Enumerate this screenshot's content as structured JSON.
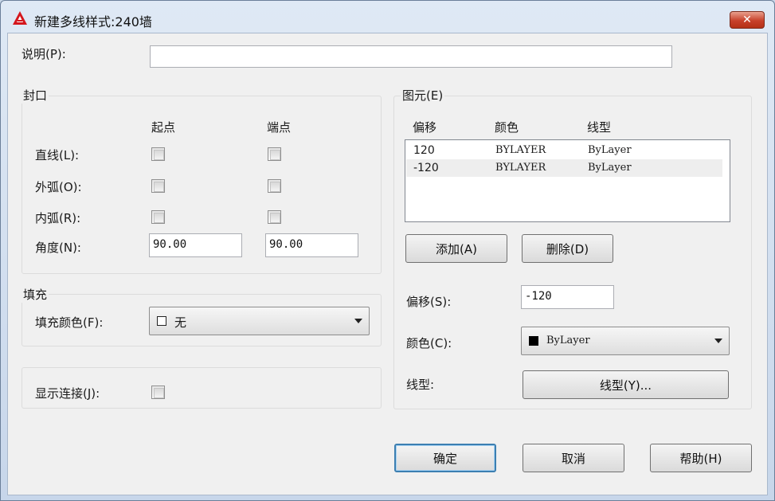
{
  "window": {
    "title": "新建多线样式:240墙",
    "close_label": "✕"
  },
  "description": {
    "label": "说明(P):",
    "value": ""
  },
  "caps": {
    "group_title": "封口",
    "col_start": "起点",
    "col_end": "端点",
    "line_label": "直线(L):",
    "outer_arc_label": "外弧(O):",
    "inner_arc_label": "内弧(R):",
    "angle_label": "角度(N):",
    "angle_start": "90.00",
    "angle_end": "90.00",
    "line_start_checked": false,
    "line_end_checked": false,
    "outer_start_checked": false,
    "outer_end_checked": false,
    "inner_start_checked": false,
    "inner_end_checked": false
  },
  "fill": {
    "group_title": "填充",
    "label": "填充颜色(F):",
    "value": "无"
  },
  "display_joints": {
    "label": "显示连接(J):",
    "checked": false
  },
  "elements": {
    "group_title": "图元(E)",
    "columns": [
      "偏移",
      "颜色",
      "线型"
    ],
    "rows": [
      {
        "offset": "120",
        "color": "BYLAYER",
        "linetype": "ByLayer"
      },
      {
        "offset": "-120",
        "color": "BYLAYER",
        "linetype": "ByLayer"
      }
    ],
    "add_label": "添加(A)",
    "delete_label": "删除(D)",
    "offset_label": "偏移(S):",
    "offset_value": "-120",
    "color_label": "颜色(C):",
    "color_value": "ByLayer",
    "linetype_label": "线型:",
    "linetype_button": "线型(Y)..."
  },
  "footer": {
    "ok_label": "确定",
    "cancel_label": "取消",
    "help_label": "帮助(H)"
  },
  "colors": {
    "accent": "#3c7fb1",
    "close": "#c7412a",
    "app_icon": "#d4161d"
  }
}
